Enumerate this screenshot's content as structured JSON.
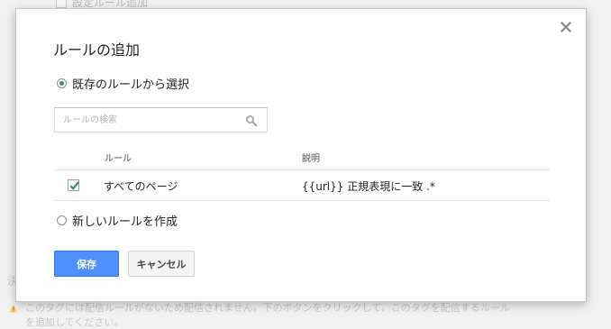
{
  "background": {
    "top_item_label": "設定ルール追加",
    "left_fragment": "決",
    "warning_line1": "このタグには配信ルールがないため配信されません。下のボタンをクリックして、このタグを配信するルール",
    "warning_line2": "を追加してください。"
  },
  "dialog": {
    "title": "ルールの追加",
    "close_icon": "close-icon",
    "option_existing": {
      "label": "既存のルールから選択",
      "selected": true
    },
    "search": {
      "placeholder": "ルールの検索",
      "value": "",
      "icon": "search-icon"
    },
    "table": {
      "columns": [
        "ルール",
        "説明"
      ],
      "rows": [
        {
          "checked": true,
          "rule": "すべてのページ",
          "description": "{{url}} 正規表現に一致 .*"
        }
      ]
    },
    "option_new": {
      "label": "新しいルールを作成",
      "selected": false
    },
    "buttons": {
      "save": "保存",
      "cancel": "キャンセル"
    }
  },
  "colors": {
    "primary_button": "#4d90fe",
    "radio_selected": "#2c9a58",
    "checkbox_check": "#2c9a58"
  }
}
